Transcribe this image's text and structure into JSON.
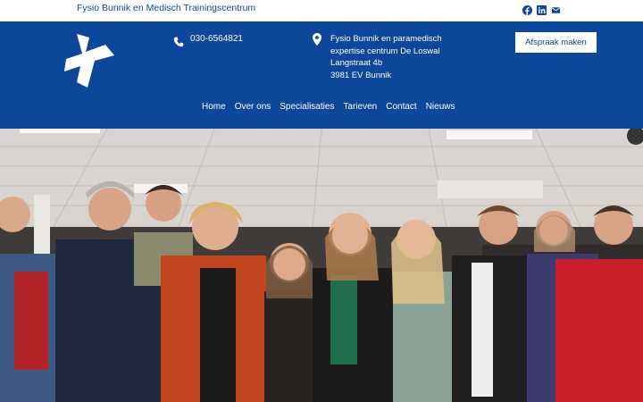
{
  "topbar": {
    "title": "Fysio Bunnik en Medisch Trainingscentrum",
    "icons": [
      "facebook-icon",
      "linkedin-icon",
      "mail-icon"
    ]
  },
  "header": {
    "phone": "030-6564821",
    "address": {
      "line1": "Fysio Bunnik en paramedisch",
      "line2": "expertise centrum De Loswal",
      "line3": "Langstraat 4b",
      "line4": "3981 EV Bunnik"
    },
    "cta_label": "Afspraak maken"
  },
  "nav": {
    "items": [
      "Home",
      "Over ons",
      "Specialisaties",
      "Tarieven",
      "Contact",
      "Nieuws"
    ]
  },
  "colors": {
    "brand_blue": "#0c479c",
    "white": "#ffffff"
  }
}
